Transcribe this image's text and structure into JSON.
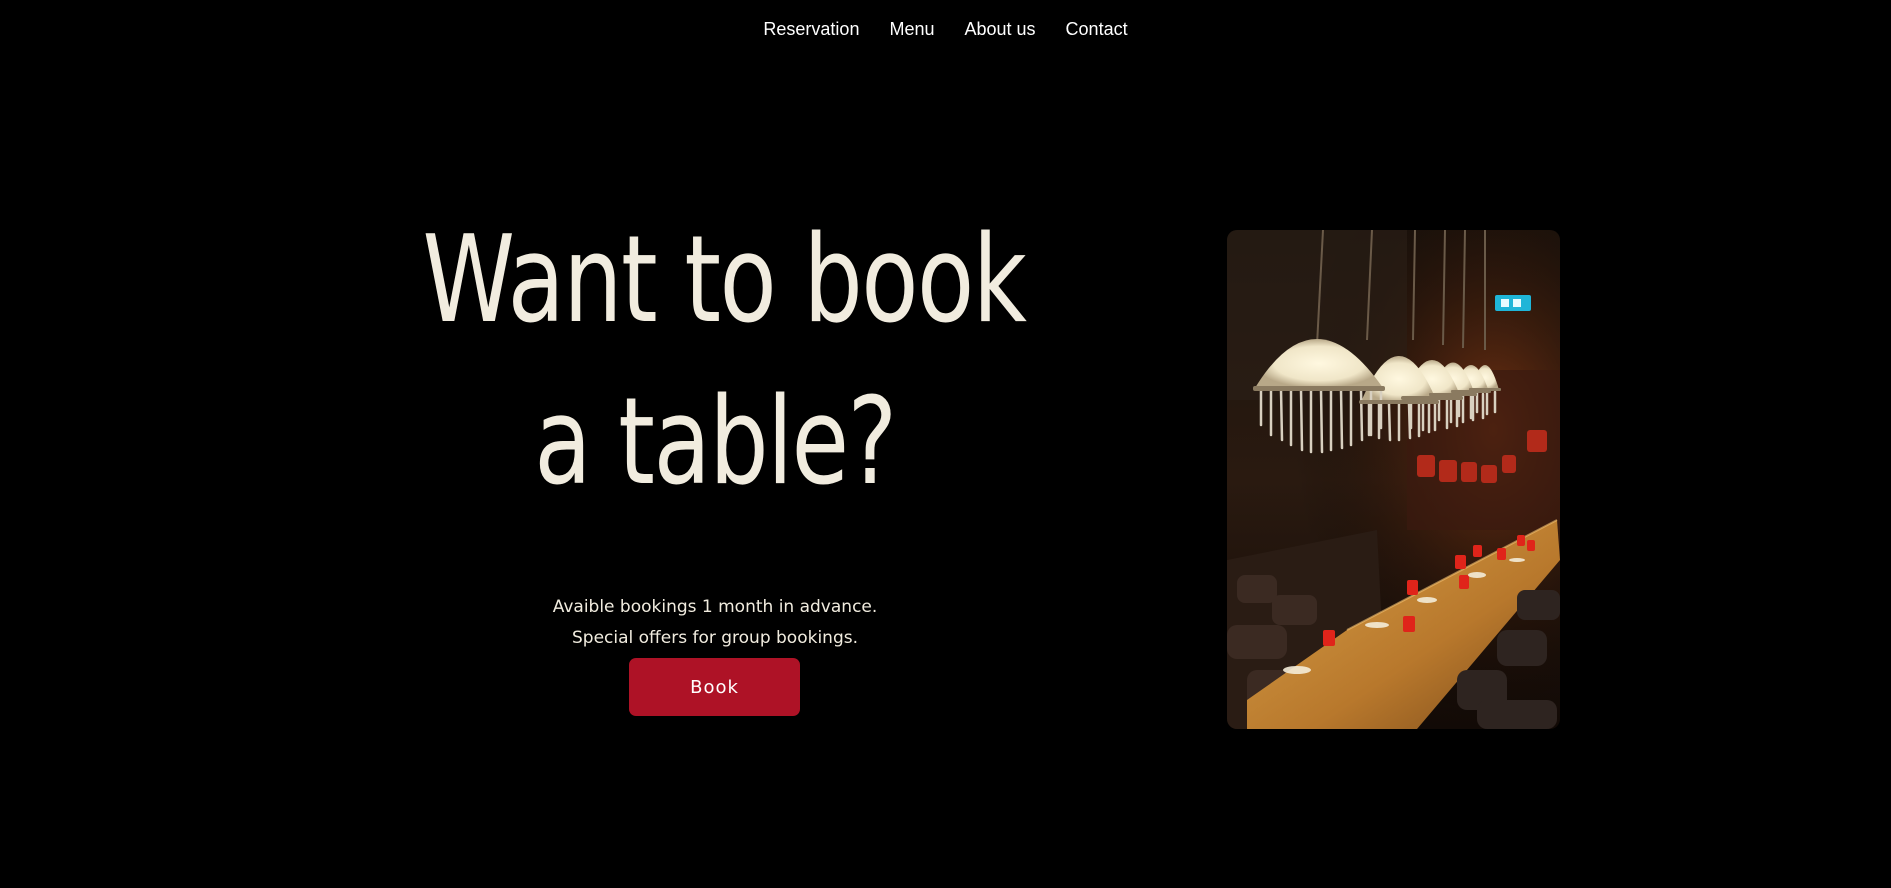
{
  "nav": {
    "items": [
      {
        "label": "Reservation"
      },
      {
        "label": "Menu"
      },
      {
        "label": "About us"
      },
      {
        "label": "Contact"
      }
    ]
  },
  "hero": {
    "headline_line1": "Want to book",
    "headline_line2": "a table?",
    "subtext_line1": "Avaible bookings 1 month in advance.",
    "subtext_line2": "Special offers for group bookings.",
    "book_label": "Book"
  },
  "colors": {
    "background": "#000000",
    "text": "#f1ecdf",
    "button": "#ae1226"
  }
}
